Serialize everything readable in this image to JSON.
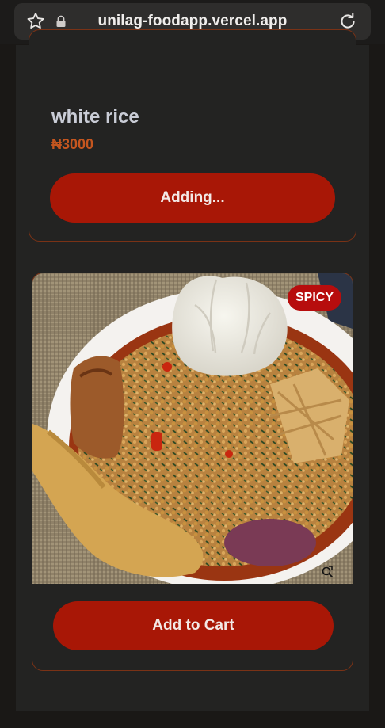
{
  "browser": {
    "url": "unilag-foodapp.vercel.app",
    "icons": [
      "star-icon",
      "lock-icon",
      "reload-icon"
    ]
  },
  "items": [
    {
      "name": "white rice",
      "price": "₦3000",
      "button_label": "Adding..."
    },
    {
      "badge": "SPICY",
      "button_label": "Add to Cart",
      "image": "egusi soup with pounded yam, meat and chicken"
    }
  ],
  "colors": {
    "accent_button": "#a81706",
    "price": "#c5561f",
    "badge": "#b70d0d",
    "card_border": "#7a3216",
    "background": "#232322"
  }
}
